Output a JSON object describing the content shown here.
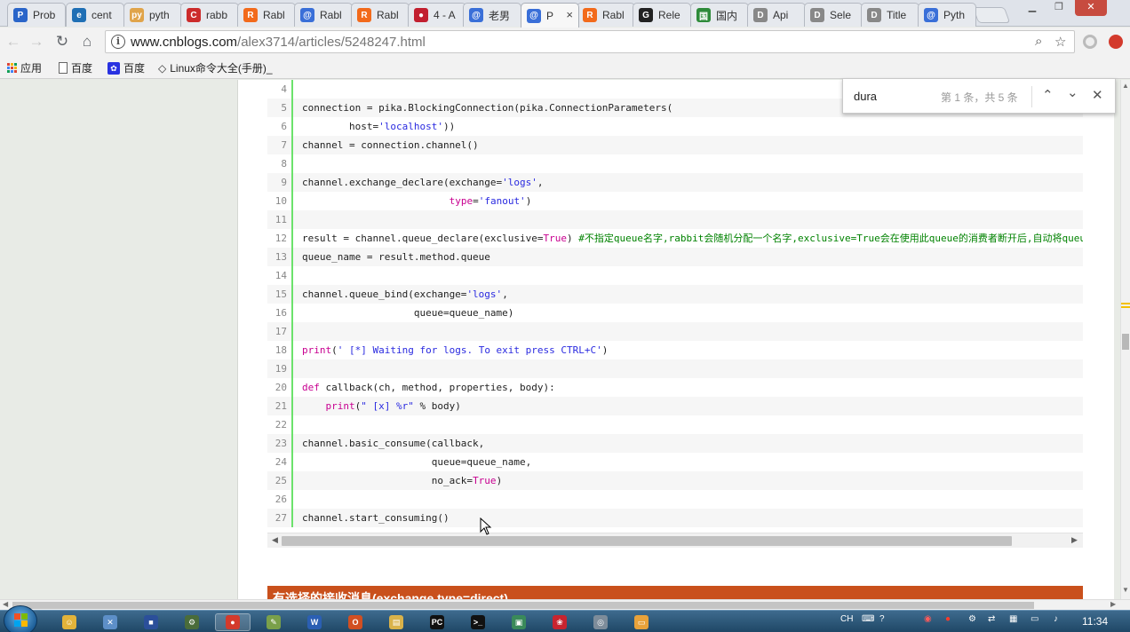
{
  "tabs": [
    {
      "label": "Prob",
      "favicon": "P",
      "color": "#2a65c9"
    },
    {
      "label": "cent",
      "favicon": "e",
      "color": "#1f6fb5"
    },
    {
      "label": "pyth",
      "favicon": "py",
      "color": "#e0a44a"
    },
    {
      "label": "rabb",
      "favicon": "C",
      "color": "#cc2b2b"
    },
    {
      "label": "Rabl",
      "favicon": "R",
      "color": "#f26a1b"
    },
    {
      "label": "Rabl",
      "favicon": "@",
      "color": "#3a6fd8"
    },
    {
      "label": "Rabl",
      "favicon": "R",
      "color": "#f26a1b"
    },
    {
      "label": "4 - A",
      "favicon": "●",
      "color": "#c21f2f"
    },
    {
      "label": "老男",
      "favicon": "@",
      "color": "#3a6fd8"
    },
    {
      "label": "P",
      "favicon": "@",
      "color": "#3a6fd8"
    },
    {
      "label": "Rabl",
      "favicon": "R",
      "color": "#f26a1b"
    },
    {
      "label": "Rele",
      "favicon": "G",
      "color": "#222222"
    },
    {
      "label": "国内",
      "favicon": "国",
      "color": "#2e8b3a"
    },
    {
      "label": "Api",
      "favicon": "D",
      "color": "#888888"
    },
    {
      "label": "Sele",
      "favicon": "D",
      "color": "#888888"
    },
    {
      "label": "Title",
      "favicon": "D",
      "color": "#888888"
    },
    {
      "label": "Pyth",
      "favicon": "@",
      "color": "#3a6fd8"
    }
  ],
  "active_tab_close": "×",
  "window_controls": [
    "minimize",
    "restore",
    "close"
  ],
  "toolbar": {
    "url_host": "www.cnblogs.com",
    "url_path": "/alex3714/articles/5248247.html"
  },
  "bookmarks": [
    {
      "label": "应用",
      "icon": "apps-grid-icon"
    },
    {
      "label": "百度",
      "icon": "page-icon"
    },
    {
      "label": "百度",
      "icon": "paw-icon"
    },
    {
      "label": "Linux命令大全(手册)_",
      "icon": "diamond-icon"
    }
  ],
  "find_bar": {
    "query": "dura",
    "count": "第 1 条，共 5 条"
  },
  "code_lines": [
    {
      "n": "4",
      "html": ""
    },
    {
      "n": "5",
      "html": "connection = pika.BlockingConnection(pika.ConnectionParameters("
    },
    {
      "n": "6",
      "html": "        host=<span class=\"str\">'localhost'</span>))"
    },
    {
      "n": "7",
      "html": "channel = connection.channel()"
    },
    {
      "n": "8",
      "html": ""
    },
    {
      "n": "9",
      "html": "channel.exchange_declare(exchange=<span class=\"str\">'logs'</span>,"
    },
    {
      "n": "10",
      "html": "                         <span class=\"kw\">type</span>=<span class=\"str\">'fanout'</span>)"
    },
    {
      "n": "11",
      "html": ""
    },
    {
      "n": "12",
      "html": "result = channel.queue_declare(exclusive=<span class=\"kw\">True</span>) <span class=\"cmt\">#不指定queue名字,rabbit会随机分配一个名字,exclusive=True会在使用此queue的消费者断开后,自动将queue删除</span>"
    },
    {
      "n": "13",
      "html": "queue_name = result.method.queue"
    },
    {
      "n": "14",
      "html": ""
    },
    {
      "n": "15",
      "html": "channel.queue_bind(exchange=<span class=\"str\">'logs'</span>,"
    },
    {
      "n": "16",
      "html": "                   queue=queue_name)"
    },
    {
      "n": "17",
      "html": ""
    },
    {
      "n": "18",
      "html": "<span class=\"bi\">print</span>(<span class=\"str\">' [*] Waiting for logs. To exit press CTRL+C'</span>)"
    },
    {
      "n": "19",
      "html": ""
    },
    {
      "n": "20",
      "html": "<span class=\"kw\">def</span> callback(ch, method, properties, body):"
    },
    {
      "n": "21",
      "html": "    <span class=\"bi\">print</span>(<span class=\"str\">\" [x] %r\"</span> % body)"
    },
    {
      "n": "22",
      "html": ""
    },
    {
      "n": "23",
      "html": "channel.basic_consume(callback,"
    },
    {
      "n": "24",
      "html": "                      queue=queue_name,"
    },
    {
      "n": "25",
      "html": "                      no_ack=<span class=\"kw\">True</span>)"
    },
    {
      "n": "26",
      "html": ""
    },
    {
      "n": "27",
      "html": "channel.start_consuming()"
    }
  ],
  "section_banner": "有选择的接收消息(exchange type=direct)",
  "taskbar": {
    "apps": [
      {
        "name": "folder-smiley-icon",
        "color": "#e2b33a",
        "glyph": "☺"
      },
      {
        "name": "tools-icon",
        "color": "#5d8fc8",
        "glyph": "✕"
      },
      {
        "name": "save-disk-icon",
        "color": "#2b4f9a",
        "glyph": "■"
      },
      {
        "name": "network-icon",
        "color": "#4a6c3a",
        "glyph": "⚙"
      },
      {
        "name": "chrome-icon",
        "color": "#d33a2c",
        "glyph": "●"
      },
      {
        "name": "notepad-icon",
        "color": "#7aa04a",
        "glyph": "✎"
      },
      {
        "name": "word-icon",
        "color": "#2b5fb3",
        "glyph": "W"
      },
      {
        "name": "office-icon",
        "color": "#d14f22",
        "glyph": "O"
      },
      {
        "name": "explorer-icon",
        "color": "#d9b24a",
        "glyph": "▤"
      },
      {
        "name": "pycharm-icon",
        "color": "#111111",
        "glyph": "PC"
      },
      {
        "name": "cmd-icon",
        "color": "#111111",
        "glyph": ">_"
      },
      {
        "name": "vm-icon",
        "color": "#3a8a5a",
        "glyph": "▣"
      },
      {
        "name": "rose-icon",
        "color": "#c8242f",
        "glyph": "❀"
      },
      {
        "name": "disk-icon",
        "color": "#7d8c9a",
        "glyph": "◎"
      },
      {
        "name": "window-icon",
        "color": "#e8a23a",
        "glyph": "▭"
      }
    ],
    "tray_lang": "CH",
    "clock": "11:34"
  }
}
